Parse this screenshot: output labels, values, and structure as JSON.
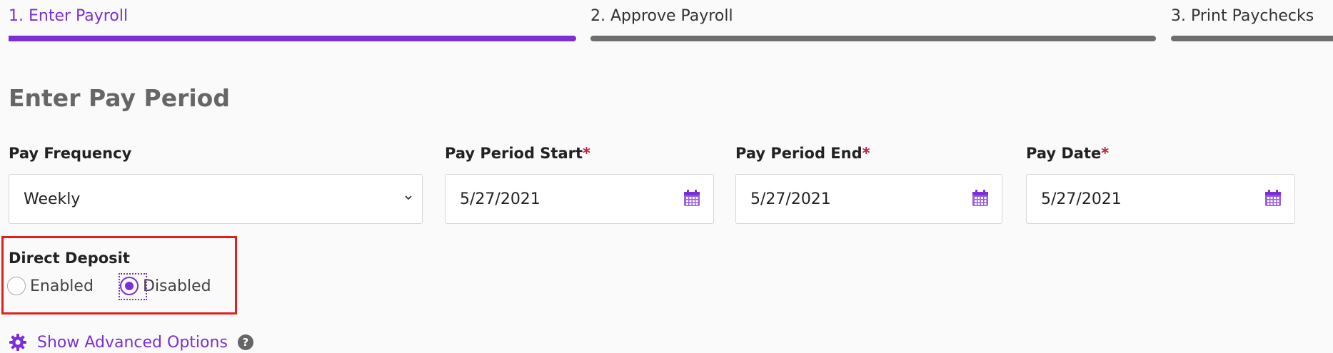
{
  "stepper": {
    "steps": [
      {
        "label": "1. Enter Payroll",
        "state": "active"
      },
      {
        "label": "2. Approve Payroll",
        "state": "inactive"
      },
      {
        "label": "3. Print Paychecks",
        "state": "inactive"
      }
    ]
  },
  "section_title": "Enter Pay Period",
  "fields": {
    "pay_frequency": {
      "label": "Pay Frequency",
      "value": "Weekly"
    },
    "pay_period_start": {
      "label": "Pay Period Start",
      "required_mark": "*",
      "value": "5/27/2021"
    },
    "pay_period_end": {
      "label": "Pay Period End",
      "required_mark": "*",
      "value": "5/27/2021"
    },
    "pay_date": {
      "label": "Pay Date",
      "required_mark": "*",
      "value": "5/27/2021"
    }
  },
  "direct_deposit": {
    "label": "Direct Deposit",
    "options": [
      {
        "label": "Enabled",
        "selected": false
      },
      {
        "label": "Disabled",
        "selected": true
      }
    ]
  },
  "advanced": {
    "label": "Show Advanced Options",
    "help_glyph": "?"
  },
  "icons": {
    "dropdown": "chevron-down-icon",
    "date": "calendar-icon",
    "advanced": "gear-icon",
    "help": "question-icon"
  },
  "colors": {
    "accent": "#7b2fd6",
    "inactive_step": "#6e6e6e",
    "required": "#c0233a",
    "highlight": "#e0201b"
  }
}
